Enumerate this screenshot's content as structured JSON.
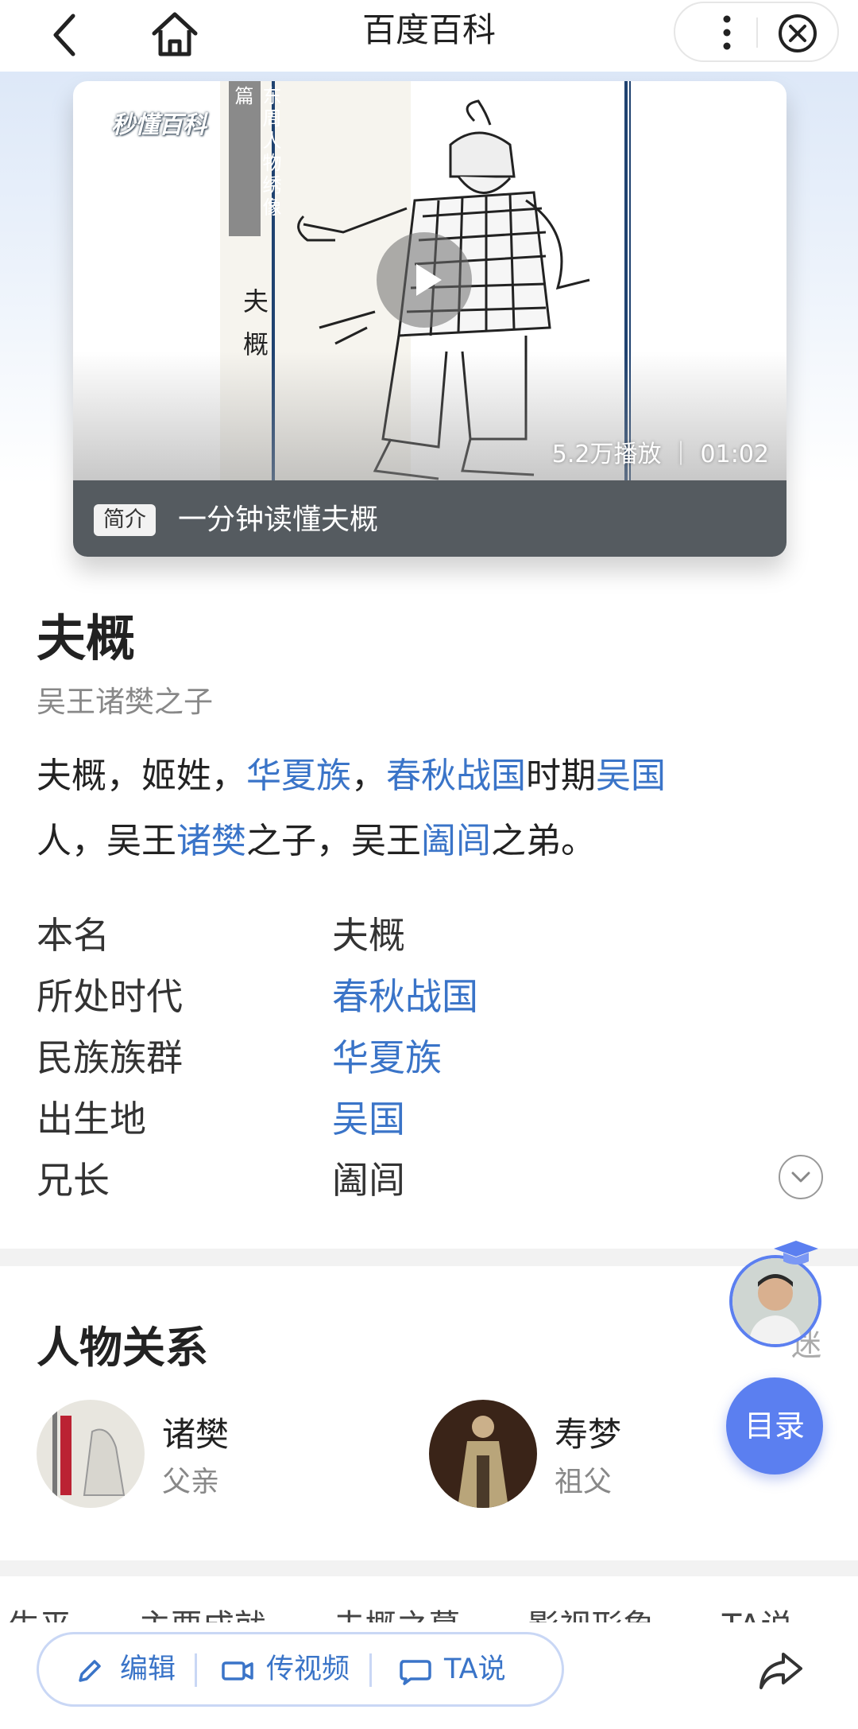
{
  "topbar": {
    "title": "百度百科"
  },
  "video": {
    "logo": "秒懂百科",
    "scroll_title": "东周人物绣像篇",
    "scroll_name": "夫概",
    "stats": "5.2万播放 ｜ 01:02",
    "badge": "简介",
    "caption": "一分钟读懂夫概"
  },
  "entry": {
    "title": "夫概",
    "subtitle": "吴王诸樊之子",
    "summary": {
      "t1": "夫概，姬姓，",
      "l1": "华夏族",
      "t2": "，",
      "l2": "春秋战国",
      "t3": "时期",
      "l3": "吴国",
      "t4": "人，吴王",
      "l4": "诸樊",
      "t5": "之子，吴王",
      "l5": "阖闾",
      "t6": "之弟。"
    }
  },
  "info": [
    {
      "key": "本名",
      "value": "夫概"
    },
    {
      "key": "所处时代",
      "value": "春秋战国"
    },
    {
      "key": "民族族群",
      "value": "华夏族"
    },
    {
      "key": "出生地",
      "value": "吴国"
    },
    {
      "key": "兄长",
      "value": "阖闾"
    }
  ],
  "relations": {
    "title": "人物关系",
    "items": [
      {
        "name": "诸樊",
        "role": "父亲"
      },
      {
        "name": "寿梦",
        "role": "祖父"
      }
    ],
    "partial_edge": "迷"
  },
  "fab": {
    "toc_label": "目录"
  },
  "tabstrip": [
    "人生平",
    "主要成就",
    "夫概之墓",
    "影视形象",
    "TA说"
  ],
  "bottom": {
    "edit": "编辑",
    "upload_video": "传视频",
    "ta_say": "TA说"
  },
  "colors": {
    "link": "#3a74c8",
    "accent": "#5b7ff0"
  }
}
